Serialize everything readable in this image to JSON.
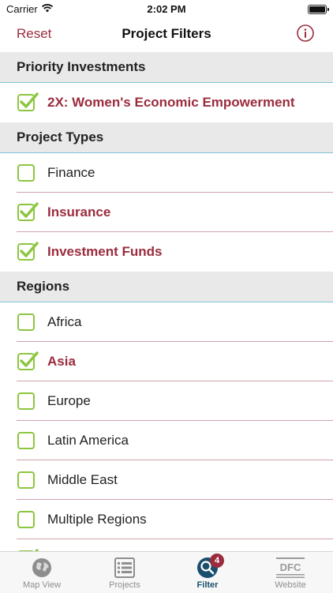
{
  "status_bar": {
    "carrier": "Carrier",
    "time": "2:02 PM"
  },
  "nav": {
    "reset_label": "Reset",
    "title": "Project Filters"
  },
  "sections": [
    {
      "title": "Priority Investments",
      "items": [
        {
          "label": "2X: Women's Economic Empowerment",
          "checked": true
        }
      ]
    },
    {
      "title": "Project Types",
      "items": [
        {
          "label": "Finance",
          "checked": false
        },
        {
          "label": "Insurance",
          "checked": true
        },
        {
          "label": "Investment Funds",
          "checked": true
        }
      ]
    },
    {
      "title": "Regions",
      "items": [
        {
          "label": "Africa",
          "checked": false
        },
        {
          "label": "Asia",
          "checked": true
        },
        {
          "label": "Europe",
          "checked": false
        },
        {
          "label": "Latin America",
          "checked": false
        },
        {
          "label": "Middle East",
          "checked": false
        },
        {
          "label": "Multiple Regions",
          "checked": false
        },
        {
          "label": "",
          "checked": true
        }
      ]
    }
  ],
  "tabs": [
    {
      "label": "Map View",
      "icon": "globe-icon",
      "active": false
    },
    {
      "label": "Projects",
      "icon": "list-icon",
      "active": false
    },
    {
      "label": "Filter",
      "icon": "magnifier-icon",
      "active": true,
      "badge": "4"
    },
    {
      "label": "Website",
      "icon": "dfc-logo-icon",
      "active": false
    }
  ],
  "colors": {
    "accent": "#9b2c3e",
    "check": "#8cc63f",
    "section_bg": "#e9e9e9",
    "divider": "#7fc4d6",
    "active_tab": "#1a4e6e"
  }
}
